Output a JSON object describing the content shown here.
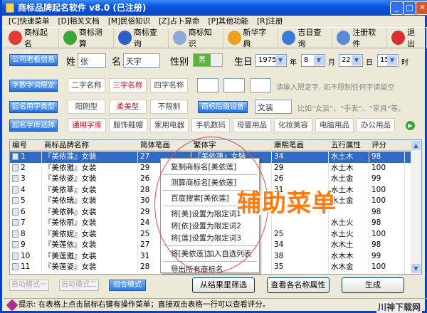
{
  "window": {
    "title": "商标品牌起名软件 v8.0 (已注册)"
  },
  "menu": [
    "[C]快速菜单",
    "[D]相关文档",
    "[M]民俗知识",
    "[Z]占卜算命",
    "[P]其他功能",
    "[R]注册"
  ],
  "toolbar": [
    {
      "label": "商标起名",
      "icon": "heart-icon",
      "color": "#e23a3a"
    },
    {
      "label": "商标测算",
      "icon": "arrow-right-icon",
      "color": "#3aa637"
    },
    {
      "label": "商标查询",
      "icon": "question-icon",
      "color": "#2c5fc8"
    },
    {
      "label": "商标知识",
      "icon": "document-icon",
      "color": "#8fa8d8"
    },
    {
      "label": "新华字典",
      "icon": "windows-logo-icon",
      "color": "#f0a020"
    },
    {
      "label": "吉日查询",
      "icon": "globe-icon",
      "color": "#3a7ad8"
    },
    {
      "label": "注册软件",
      "icon": "computer-icon",
      "color": "#5a8ad8"
    },
    {
      "label": "退出",
      "icon": "close-x-icon",
      "color": "#d83030"
    }
  ],
  "form": {
    "company_btn": "公司老板信息",
    "surname_label": "姓",
    "surname": "张",
    "name_label": "名",
    "given_name": "天宇",
    "gender_label": "性别",
    "gender": "男",
    "birthday_label": "生日",
    "year": "1975",
    "year_unit": "年",
    "month": "8",
    "month_unit": "月",
    "day": "22",
    "day_unit": "日",
    "hour": "15",
    "hour_unit": "时",
    "count_btn": "字数字词限定",
    "count_opts": [
      "二字名称",
      "三字名称",
      "四字名称"
    ],
    "limit_hint": "请输入限定字, 如不限制任何字请留空",
    "type_btn": "起名用字类型",
    "type_opts": [
      "阳刚型",
      "柔美型",
      "不限制"
    ],
    "suffix_btn": "商标后缀设置",
    "suffix": "文装",
    "suffix_hint": "比如“女装”、“手表”、“家具”等。",
    "lib_btn": "起名字库选择",
    "lib_opts": [
      "通用字库",
      "服饰鞋帽",
      "家用电器",
      "手机数码",
      "母婴用品",
      "化妆美容",
      "电脑用品",
      "办公用品"
    ],
    "selected_count": "三字名称",
    "selected_type": "柔美型",
    "selected_lib": "通用字库"
  },
  "table": {
    "headers": [
      "编号",
      "商标品牌名称",
      "简体笔画",
      "繁体字",
      "康熙笔画",
      "五行属性",
      "评分"
    ],
    "rows": [
      [
        "1",
        "『美依莲』女装",
        "27",
        "『美依蓮』女裝",
        "34",
        "水土木",
        "98"
      ],
      [
        "2",
        "『美依雅』女装",
        "29",
        "",
        "29",
        "水土木",
        "100"
      ],
      [
        "3",
        "『美依姿』女装",
        "26",
        "",
        "26",
        "水土金",
        "99"
      ],
      [
        "4",
        "『美依莘』女装",
        "28",
        "",
        "31",
        "水土木",
        "100"
      ],
      [
        "5",
        "『美依瑞』女装",
        "30",
        "",
        "",
        "水土金",
        "100"
      ],
      [
        "6",
        "『美依韩』女装",
        "29",
        "",
        "",
        "",
        "98"
      ],
      [
        "7",
        "『美依丽』女装",
        "24",
        "",
        "",
        "水土火",
        "98"
      ],
      [
        "8",
        "『美依妮』女装",
        "25",
        "",
        "25",
        "水土火",
        "100"
      ],
      [
        "9",
        "『美莲依』女装",
        "27",
        "",
        "34",
        "水木土",
        "98"
      ],
      [
        "10",
        "『美莲雅』女装",
        "31",
        "",
        "38",
        "水木木",
        "99"
      ],
      [
        "11",
        "『美莲姿』女装",
        "28",
        "",
        "35",
        "水木金",
        "100"
      ],
      [
        "12",
        "『美莲莘』女装",
        "30",
        "",
        "40",
        "水木木",
        "99"
      ],
      [
        "13",
        "『美莲瑞』女装",
        "32",
        "『美蓮瑞』女裝",
        "40",
        "水木金",
        "99"
      ]
    ]
  },
  "context_menu": [
    "复制商标名[美依莲]",
    "测算商标名[美依莲]",
    "百度搜索[美依莲]",
    "将[美]设置为限定词1",
    "将[依]设置为限定词2",
    "将[莲]设置为限定词3",
    "将[美依莲]加入自选列表",
    "导出所有商标名"
  ],
  "overlay_label": "辅助菜单",
  "modes": [
    "自动模式一",
    "自动模式二",
    "组合模式"
  ],
  "active_mode": "组合模式",
  "actions": [
    "从结果里筛选",
    "查看各名称属性",
    "生成"
  ],
  "status": "提示: 在表格上点击鼠标右键有操作菜单；直接双击表格一行可以查看评分。",
  "watermark": "川神下载网"
}
